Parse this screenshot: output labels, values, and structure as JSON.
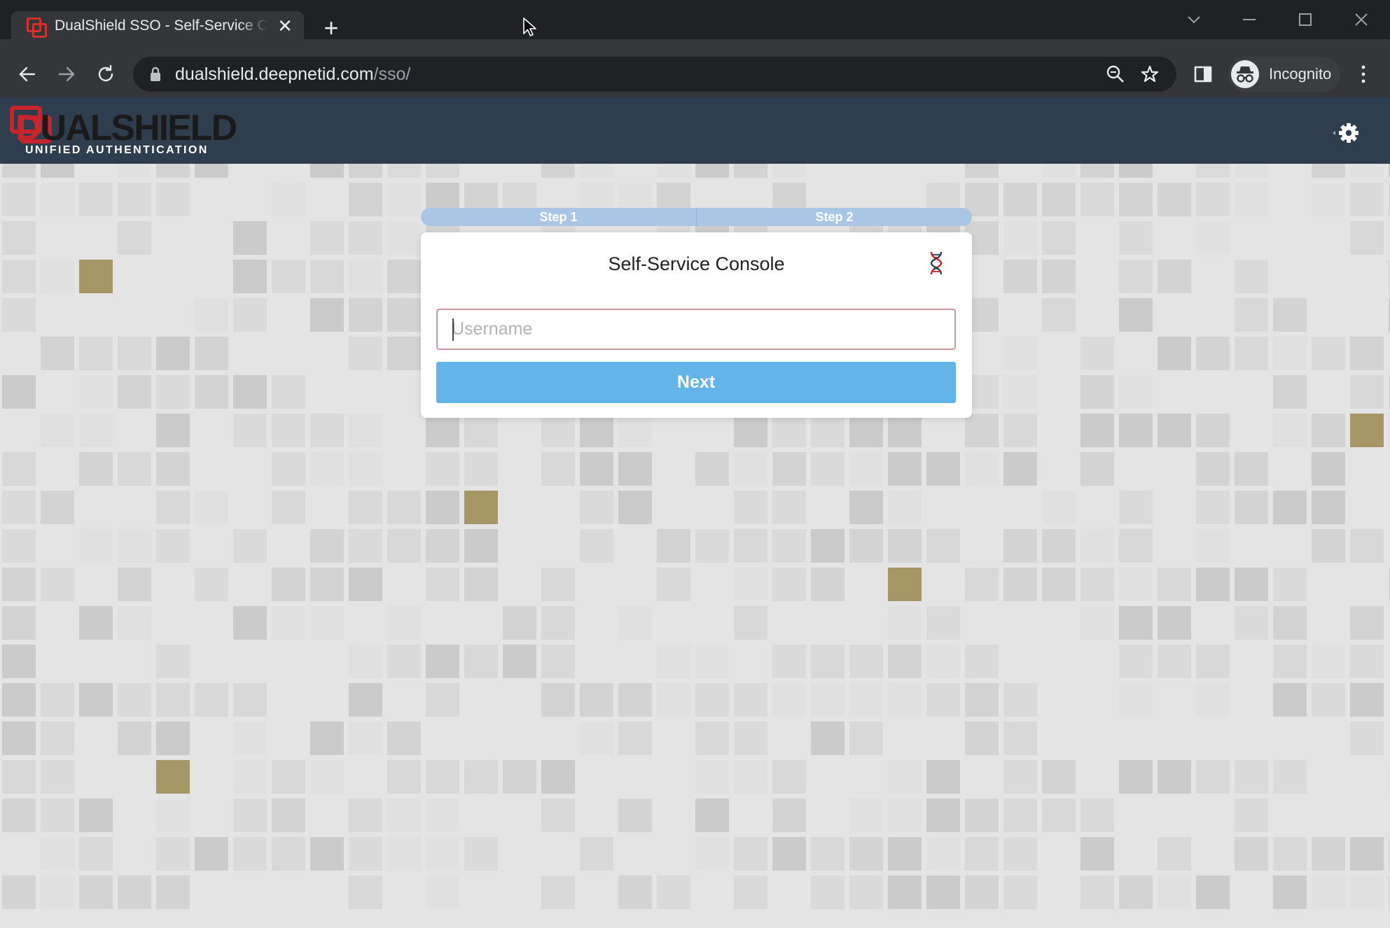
{
  "browser": {
    "tab_title": "DualShield SSO - Self-Service Console",
    "tab_close": "✕",
    "new_tab": "+",
    "url_host": "dualshield.deepnetid.com",
    "url_path": "/sso/",
    "profile_label": "Incognito"
  },
  "app": {
    "logo_word_accent": "D",
    "logo_word": "UALSHIELD",
    "logo_tagline": "UNIFIED AUTHENTICATION"
  },
  "wizard": {
    "steps": [
      {
        "label": "Step 1"
      },
      {
        "label": "Step 2"
      }
    ]
  },
  "login": {
    "title": "Self-Service Console",
    "username_placeholder": "Username",
    "username_value": "",
    "next_label": "Next"
  },
  "colors": {
    "header_bg": "#2f3e4e",
    "accent_blue": "#63b4e8",
    "brand_red": "#c8242b",
    "mosaic_gold": "#a89766"
  },
  "icons": [
    "back-arrow-icon",
    "forward-arrow-icon",
    "reload-icon",
    "lock-icon",
    "zoom-icon",
    "star-icon",
    "side-panel-icon",
    "incognito-icon",
    "kebab-menu-icon",
    "gear-icon",
    "dna-icon"
  ]
}
